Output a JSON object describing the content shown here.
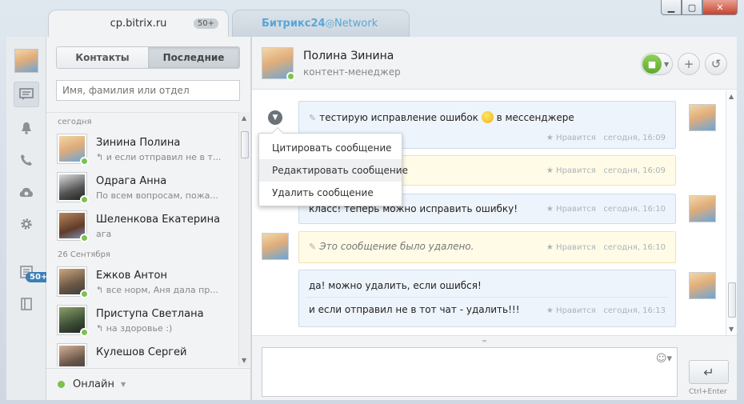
{
  "window": {
    "controls": {
      "min": "▁",
      "max": "▢",
      "close": "✕"
    }
  },
  "tabs": [
    {
      "label": "cp.bitrix.ru",
      "badge": "50+"
    },
    {
      "brand": "Битрикс24",
      "brand_suffix": "Network"
    }
  ],
  "rail": {
    "badge": "50+",
    "icons": [
      "avatar",
      "chat-icon",
      "bell-icon",
      "phone-icon",
      "disk-icon",
      "gear-icon",
      "calendar-icon",
      "book-icon"
    ]
  },
  "contacts": {
    "tab_contacts": "Контакты",
    "tab_recent": "Последние",
    "search_placeholder": "Имя, фамилия или отдел",
    "groups": [
      {
        "label": "сегодня",
        "items": [
          {
            "name": "Зинина Полина",
            "last": "↰ и если отправил не в т..."
          },
          {
            "name": "Одрага Анна",
            "last": "По всем вопросам, пожа..."
          },
          {
            "name": "Шеленкова Екатерина",
            "last": "ага"
          }
        ]
      },
      {
        "label": "26 Сентября",
        "items": [
          {
            "name": "Ежков Антон",
            "last": "↰ все норм, Аня дала пр..."
          },
          {
            "name": "Приступа Светлана",
            "last": "↰ на здоровье :)"
          },
          {
            "name": "Кулешов Сергей",
            "last": ""
          }
        ]
      }
    ],
    "status": "Онлайн"
  },
  "chat": {
    "name": "Полина Зинина",
    "role": "контент-менеджер",
    "like": "★ Нравится",
    "messages": [
      {
        "text": "тестирую исправление ошибок",
        "text_after": "в мессенджере",
        "time": "сегодня, 16:09"
      },
      {
        "text": "",
        "time": "сегодня, 16:09"
      },
      {
        "text": "класс! теперь можно исправить ошибку!",
        "time": "сегодня, 16:10"
      },
      {
        "text": "Это сообщение было удалено.",
        "time": "сегодня, 16:10"
      },
      {
        "text": "да! можно удалить, если ошибся!",
        "text2": "и если отправил не в тот чат - удалить!!!",
        "time": "сегодня, 16:13"
      }
    ],
    "context_menu": [
      "Цитировать сообщение",
      "Редактировать сообщение",
      "Удалить сообщение"
    ],
    "send_hint": "Ctrl+Enter"
  }
}
